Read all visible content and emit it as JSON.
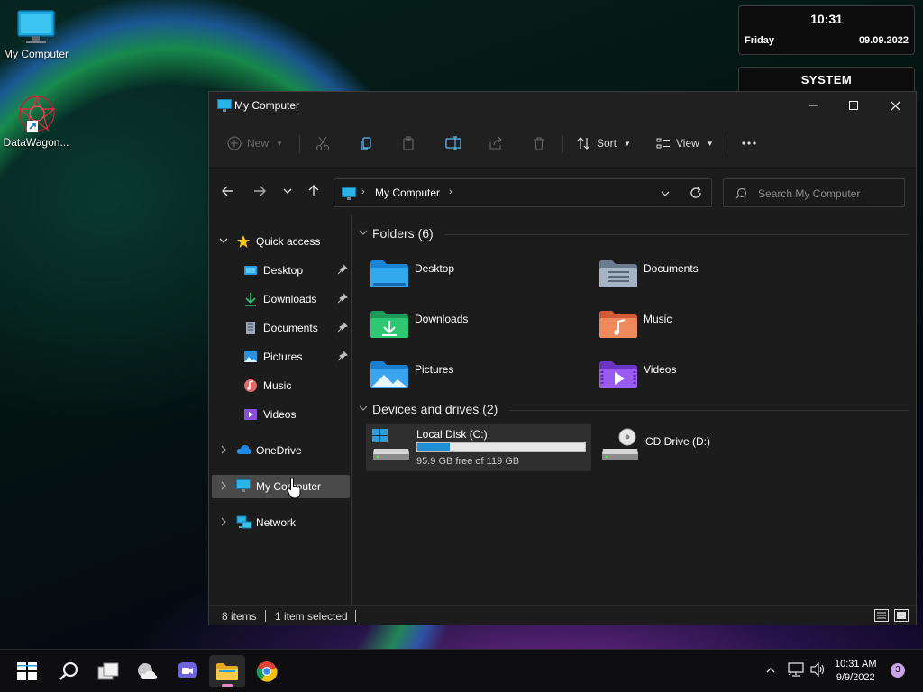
{
  "desktop": {
    "icons": [
      {
        "label": "My Computer",
        "icon": "monitor-icon"
      },
      {
        "label": "DataWagon...",
        "icon": "datawagon-shortcut-icon"
      }
    ]
  },
  "widgets": {
    "clock": {
      "time": "10:31",
      "day": "Friday",
      "date": "09.09.2022"
    },
    "system": {
      "title": "SYSTEM"
    }
  },
  "window": {
    "title": "My Computer",
    "toolbar": {
      "new_label": "New",
      "sort_label": "Sort",
      "view_label": "View"
    },
    "address": {
      "location": "My Computer"
    },
    "search": {
      "placeholder": "Search My Computer"
    },
    "nav_pane": {
      "quick_access": "Quick access",
      "items": [
        {
          "label": "Desktop",
          "icon": "desktop-folder-icon",
          "pinned": true
        },
        {
          "label": "Downloads",
          "icon": "download-icon",
          "pinned": true
        },
        {
          "label": "Documents",
          "icon": "document-icon",
          "pinned": true
        },
        {
          "label": "Pictures",
          "icon": "pictures-icon",
          "pinned": true
        },
        {
          "label": "Music",
          "icon": "music-icon",
          "pinned": false
        },
        {
          "label": "Videos",
          "icon": "videos-icon",
          "pinned": false
        }
      ],
      "onedrive": "OneDrive",
      "my_computer": "My Computer",
      "network": "Network"
    },
    "content": {
      "folders_header": "Folders (6)",
      "folders": [
        {
          "label": "Desktop",
          "icon": "desktop-folder-icon"
        },
        {
          "label": "Documents",
          "icon": "documents-folder-icon"
        },
        {
          "label": "Downloads",
          "icon": "downloads-folder-icon"
        },
        {
          "label": "Music",
          "icon": "music-folder-icon"
        },
        {
          "label": "Pictures",
          "icon": "pictures-folder-icon"
        },
        {
          "label": "Videos",
          "icon": "videos-folder-icon"
        }
      ],
      "drives_header": "Devices and drives (2)",
      "drives": [
        {
          "label": "Local Disk (C:)",
          "free_text": "95.9 GB free of 119 GB",
          "used_fraction": 0.194
        },
        {
          "label": "CD Drive (D:)"
        }
      ]
    },
    "status": {
      "items": "8 items",
      "selected": "1 item selected"
    }
  },
  "taskbar": {
    "clock": {
      "time": "10:31 AM",
      "date": "9/9/2022"
    },
    "notification_count": "3"
  },
  "colors": {
    "accent": "#1f8fd8",
    "selection": "#4a4a4a",
    "window_bg": "#1c1c1c"
  }
}
